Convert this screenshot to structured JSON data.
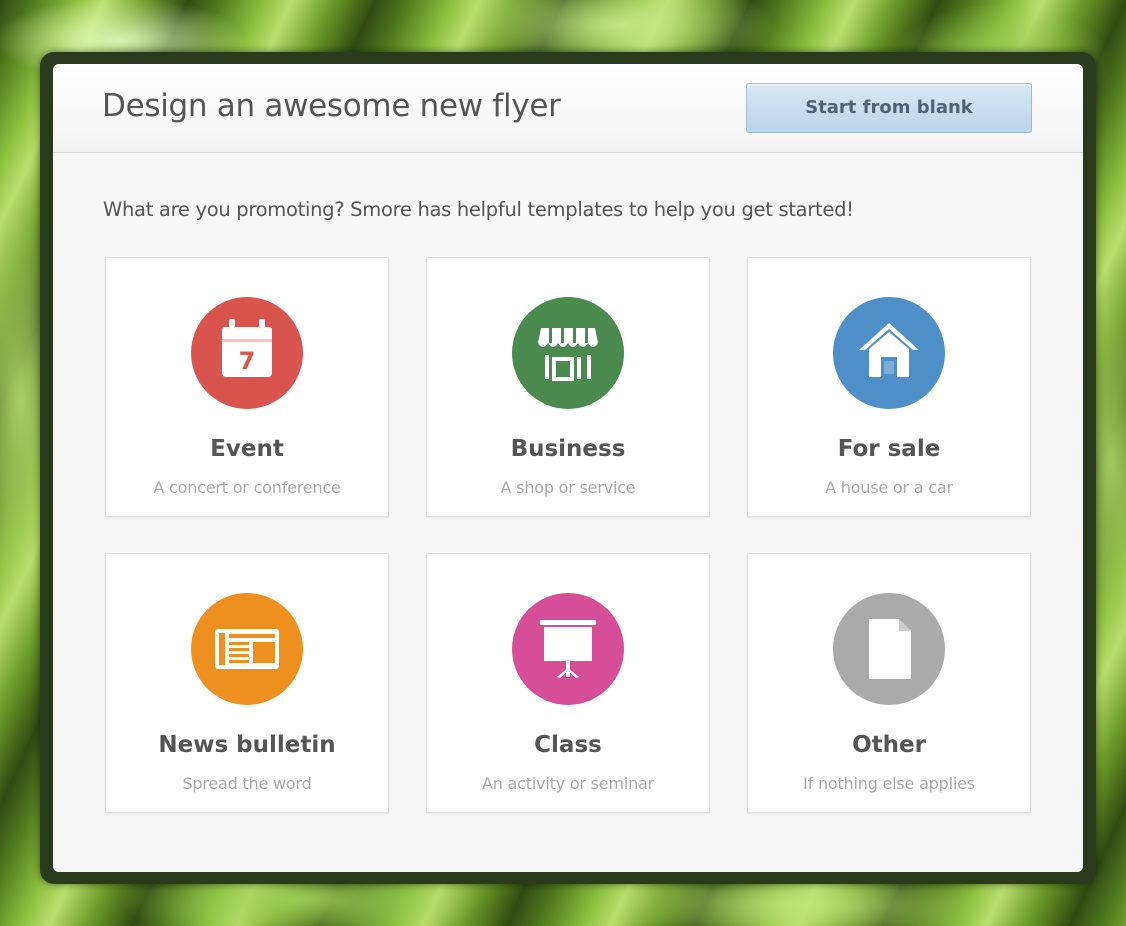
{
  "modal": {
    "title": "Design an awesome new flyer",
    "start_blank_label": "Start from blank",
    "prompt": "What are you promoting? Smore has helpful templates to help you get started!"
  },
  "categories": [
    {
      "label": "Event",
      "description": "A concert or conference",
      "icon": "calendar-icon",
      "color": "#d9534f",
      "calendar_day": "7"
    },
    {
      "label": "Business",
      "description": "A shop or service",
      "icon": "storefront-icon",
      "color": "#4a8a4f"
    },
    {
      "label": "For sale",
      "description": "A house or a car",
      "icon": "house-icon",
      "color": "#4f8fc8"
    },
    {
      "label": "News bulletin",
      "description": "Spread the word",
      "icon": "newspaper-icon",
      "color": "#ee9020"
    },
    {
      "label": "Class",
      "description": "An activity or seminar",
      "icon": "presentation-board-icon",
      "color": "#d64d98"
    },
    {
      "label": "Other",
      "description": "If nothing else applies",
      "icon": "document-icon",
      "color": "#aaaaaa"
    }
  ]
}
